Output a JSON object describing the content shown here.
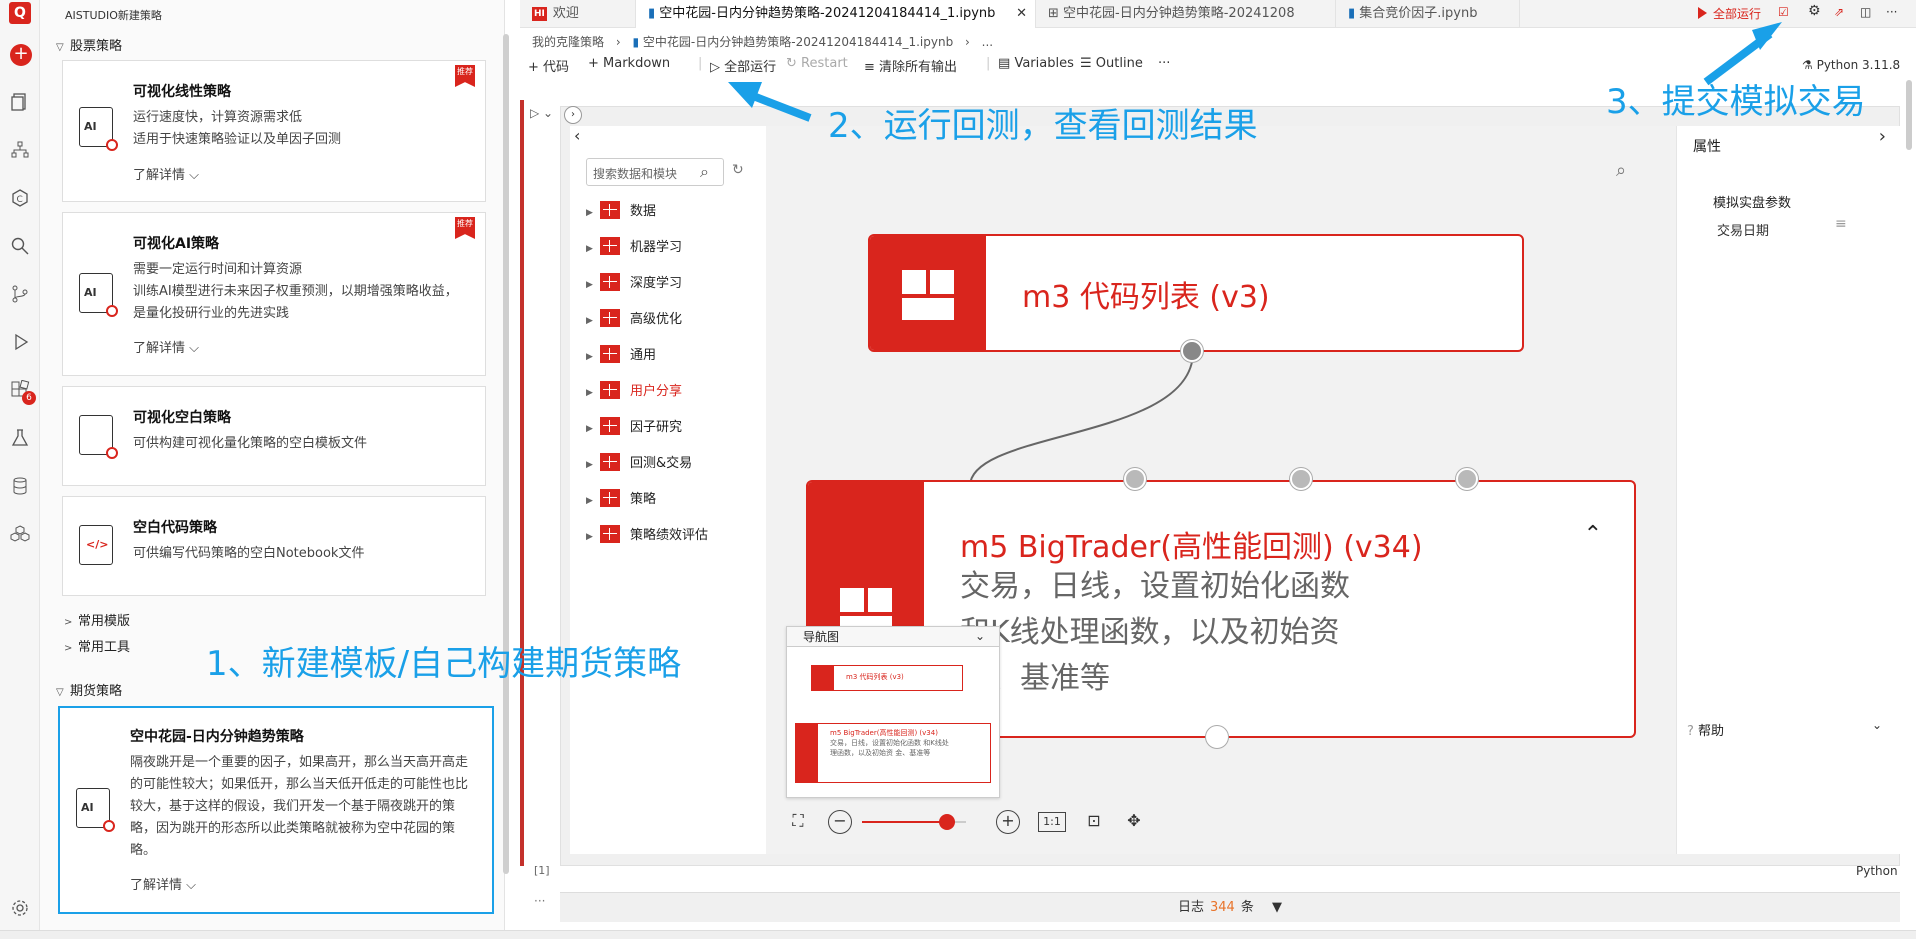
{
  "app": {
    "sidebar_title": "AISTUDIO新建策略",
    "logo_text": "Q"
  },
  "activity": {
    "extensions_badge": "6"
  },
  "sidebar": {
    "stock_section": "股票策略",
    "cards": [
      {
        "title": "可视化线性策略",
        "desc": "运行速度快，计算资源需求低\n适用于快速策略验证以及单因子回测",
        "more": "了解详情",
        "tag": "推荐",
        "icon": "AI"
      },
      {
        "title": "可视化AI策略",
        "desc": "需要一定运行时间和计算资源\n训练AI模型进行未来因子权重预测，以期增强策略收益，是量化投研行业的先进实践",
        "more": "了解详情",
        "tag": "推荐",
        "icon": "AI"
      },
      {
        "title": "可视化空白策略",
        "desc": "可供构建可视化量化策略的空白模板文件",
        "more": "",
        "tag": "",
        "icon": "blank"
      },
      {
        "title": "空白代码策略",
        "desc": "可供编写代码策略的空白Notebook文件",
        "more": "",
        "tag": "",
        "icon": "code"
      }
    ],
    "common_templates": "常用模版",
    "common_tools": "常用工具",
    "futures_section": "期货策略",
    "futures_card": {
      "title": "空中花园-日内分钟趋势策略",
      "desc": "隔夜跳开是一个重要的因子，如果高开，那么当天高开高走的可能性较大；如果低开，那么当天低开低走的可能性也比较大，基于这样的假设，我们开发一个基于隔夜跳开的策略，因为跳开的形态所以此类策略就被称为空中花园的策略。",
      "more": "了解详情",
      "icon": "AI"
    }
  },
  "tabs": [
    {
      "label": "欢迎",
      "badge": "HI"
    },
    {
      "label": "空中花园-日内分钟趋势策略-20241204184414_1.ipynb",
      "active": true
    },
    {
      "label": "空中花园-日内分钟趋势策略-20241208"
    },
    {
      "label": "集合竞价因子.ipynb"
    }
  ],
  "topright": {
    "run_all": "全部运行"
  },
  "breadcrumb": {
    "root": "我的克隆策略",
    "file": "空中花园-日内分钟趋势策略-20241204184414_1.ipynb",
    "tail": "..."
  },
  "toolbar": {
    "code": "代码",
    "markdown": "Markdown",
    "run_all": "全部运行",
    "restart": "Restart",
    "clear": "清除所有输出",
    "variables": "Variables",
    "outline": "Outline",
    "more": "···"
  },
  "kernel": {
    "python": "Python 3.11.8"
  },
  "annotations": {
    "a1": "1、新建模板/自己构建期货策略",
    "a2": "2、运行回测，查看回测结果",
    "a3": "3、提交模拟交易"
  },
  "palette": {
    "search_placeholder": "搜索数据和模块",
    "items": [
      "数据",
      "机器学习",
      "深度学习",
      "高级优化",
      "通用",
      "用户分享",
      "因子研究",
      "回测&交易",
      "策略",
      "策略绩效评估"
    ],
    "highlight_index": 5
  },
  "canvas": {
    "node1": {
      "title": "m3 代码列表 (v3)"
    },
    "node2": {
      "title": "m5 BigTrader(高性能回测) (v34)",
      "desc_l1": "交易，日线，设置初始化函数",
      "desc_l2": "和K线处理函数，以及初始资",
      "desc_l3": "金、基准等"
    },
    "minimap": {
      "title": "导航图",
      "n1": "m3 代码列表 (v3)",
      "n2": "m5 BigTrader(高性能回测) (v34)",
      "n2desc": "交易，日线，设置初始化函数 和K线处理函数，以及初始资 金、基准等"
    },
    "zoom": {
      "value": 0.82,
      "reset": "1:1"
    }
  },
  "props": {
    "title": "属性",
    "section": "模拟实盘参数",
    "row": "交易日期",
    "help": "帮助"
  },
  "cell": {
    "label": "[1]",
    "lang": "Python"
  },
  "log": {
    "prefix": "日志",
    "count": "344",
    "suffix": "条"
  },
  "colors": {
    "brand_red": "#d9251d",
    "annotation_blue": "#1aa0e8"
  }
}
